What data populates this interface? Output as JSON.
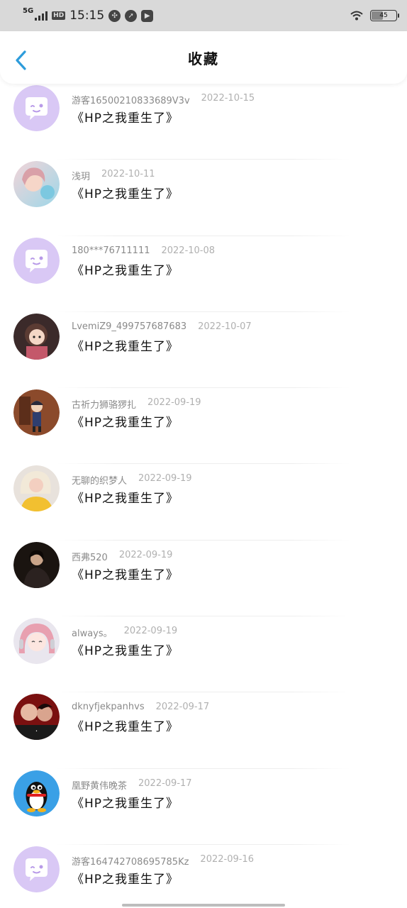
{
  "status_bar": {
    "network": "5G",
    "hd": "HD",
    "time": "15:15",
    "battery": "45"
  },
  "header": {
    "title": "收藏"
  },
  "colors": {
    "accent": "#2d9cdb",
    "default_avatar": "#d9c8f5"
  },
  "favorites": [
    {
      "user": "游客16500210833689V3v",
      "date": "2022-10-15",
      "book": "《HP之我重生了》",
      "avatar": "default"
    },
    {
      "user": "浅玥",
      "date": "2022-10-11",
      "book": "《HP之我重生了》",
      "avatar": "photo-pink"
    },
    {
      "user": "180***76711111",
      "date": "2022-10-08",
      "book": "《HP之我重生了》",
      "avatar": "default"
    },
    {
      "user": "LvemiZ9_499757687683",
      "date": "2022-10-07",
      "book": "《HP之我重生了》",
      "avatar": "photo-cartoon-girl"
    },
    {
      "user": "古祈力狮骆猡扎",
      "date": "2022-09-19",
      "book": "《HP之我重生了》",
      "avatar": "photo-detective"
    },
    {
      "user": "无聊的织梦人",
      "date": "2022-09-19",
      "book": "《HP之我重生了》",
      "avatar": "photo-blonde"
    },
    {
      "user": "西弗520",
      "date": "2022-09-19",
      "book": "《HP之我重生了》",
      "avatar": "photo-dark"
    },
    {
      "user": "always。",
      "date": "2022-09-19",
      "book": "《HP之我重生了》",
      "avatar": "photo-anime"
    },
    {
      "user": "dknyfjekpanhvs",
      "date": "2022-09-17",
      "book": "《HP之我重生了》",
      "avatar": "photo-red"
    },
    {
      "user": "凰野黄伟晚茶",
      "date": "2022-09-17",
      "book": "《HP之我重生了》",
      "avatar": "penguin"
    },
    {
      "user": "游客164742708695785Kz",
      "date": "2022-09-16",
      "book": "《HP之我重生了》",
      "avatar": "default"
    }
  ]
}
